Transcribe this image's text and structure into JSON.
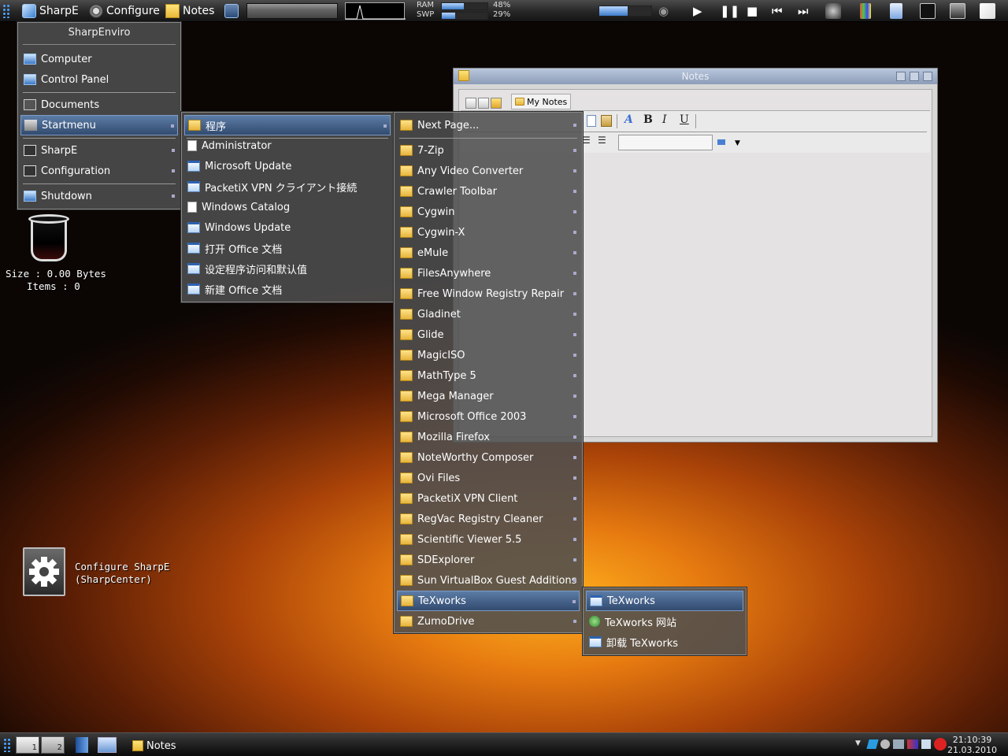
{
  "topbar": {
    "sharpe_label": "SharpE",
    "configure_label": "Configure",
    "notes_label": "Notes",
    "ram_label": "RAM",
    "swp_label": "SWP",
    "ram_percent": "48%",
    "swp_percent": "29%",
    "ram_fraction": 0.48,
    "swp_fraction": 0.29,
    "volume_fraction": 0.55
  },
  "main_menu": {
    "title": "SharpEnviro",
    "items": [
      {
        "label": "Computer",
        "icon": "computer-icon"
      },
      {
        "label": "Control Panel",
        "icon": "control-panel-icon"
      },
      {
        "label": "Documents",
        "icon": "documents-icon"
      },
      {
        "label": "Startmenu",
        "icon": "startmenu-icon"
      },
      {
        "label": "SharpE",
        "icon": "sharpe-icon"
      },
      {
        "label": "Configuration",
        "icon": "configuration-icon"
      },
      {
        "label": "Shutdown",
        "icon": "shutdown-icon"
      }
    ]
  },
  "programs_menu": {
    "items": [
      {
        "label": "程序",
        "icon": "folder-icon"
      },
      {
        "label": "Administrator",
        "icon": "document-icon"
      },
      {
        "label": "Microsoft Update",
        "icon": "window-icon"
      },
      {
        "label": "PacketiX VPN クライアント接続",
        "icon": "window-icon"
      },
      {
        "label": "Windows Catalog",
        "icon": "document-icon"
      },
      {
        "label": "Windows Update",
        "icon": "window-icon"
      },
      {
        "label": "打开 Office 文档",
        "icon": "window-icon"
      },
      {
        "label": "设定程序访问和默认值",
        "icon": "window-icon"
      },
      {
        "label": "新建 Office 文档",
        "icon": "window-icon"
      }
    ]
  },
  "folders_menu": {
    "items": [
      "Next Page...",
      "7-Zip",
      "Any Video Converter",
      "Crawler Toolbar",
      "Cygwin",
      "Cygwin-X",
      "eMule",
      "FilesAnywhere",
      "Free Window Registry Repair",
      "Gladinet",
      "Glide",
      "MagicISO",
      "MathType 5",
      "Mega Manager",
      "Microsoft Office 2003",
      "Mozilla Firefox",
      "NoteWorthy Composer",
      "Ovi Files",
      "PacketiX VPN Client",
      "RegVac Registry Cleaner",
      "Scientific Viewer 5.5",
      "SDExplorer",
      "Sun VirtualBox Guest Additions",
      "TeXworks",
      "ZumoDrive"
    ]
  },
  "texworks_menu": {
    "items": [
      {
        "label": "TeXworks",
        "icon": "window-icon"
      },
      {
        "label": "TeXworks 网站",
        "icon": "globe-icon"
      },
      {
        "label": "卸载 TeXworks",
        "icon": "window-icon"
      }
    ]
  },
  "notes_window": {
    "title": "Notes",
    "tab_label": "My Notes",
    "bold": "B",
    "italic": "I",
    "underline": "U",
    "font_color": "A"
  },
  "desktop": {
    "trash_size": "Size : 0.00 Bytes",
    "trash_items": "Items : 0",
    "configure_line1": "Configure SharpE",
    "configure_line2": "(SharpCenter)"
  },
  "bottombar": {
    "desk1": "1",
    "desk2": "2",
    "notes_label": "Notes",
    "time": "21:10:39",
    "date": "21.03.2010"
  }
}
